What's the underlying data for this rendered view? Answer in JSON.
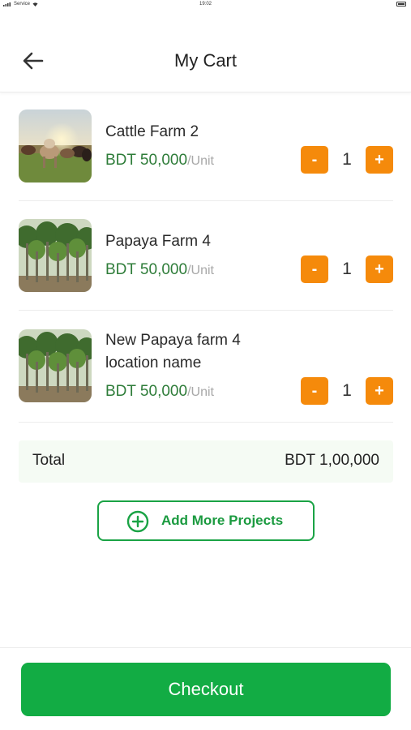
{
  "status_bar": {
    "carrier": "Service",
    "time": "19:02"
  },
  "header": {
    "title": "My Cart"
  },
  "cart": {
    "items": [
      {
        "name": "Cattle Farm 2",
        "price": "BDT 50,000",
        "unit": "/Unit",
        "quantity": "1",
        "minus": "-",
        "plus": "+",
        "image": "cattle-farm-photo"
      },
      {
        "name": "Papaya Farm 4",
        "price": "BDT 50,000",
        "unit": "/Unit",
        "quantity": "1",
        "minus": "-",
        "plus": "+",
        "image": "papaya-farm-photo"
      },
      {
        "name": "New Papaya farm 4 location name",
        "price": "BDT 50,000",
        "unit": "/Unit",
        "quantity": "1",
        "minus": "-",
        "plus": "+",
        "image": "papaya-farm-photo"
      }
    ]
  },
  "summary": {
    "total_label": "Total",
    "total_value": "BDT 1,00,000"
  },
  "actions": {
    "add_more_label": "Add More Projects",
    "checkout_label": "Checkout"
  },
  "colors": {
    "accent_green": "#12ac44",
    "price_green": "#2f7d3a",
    "stepper_orange": "#f58a0b",
    "total_bg": "#f5fbf4"
  }
}
